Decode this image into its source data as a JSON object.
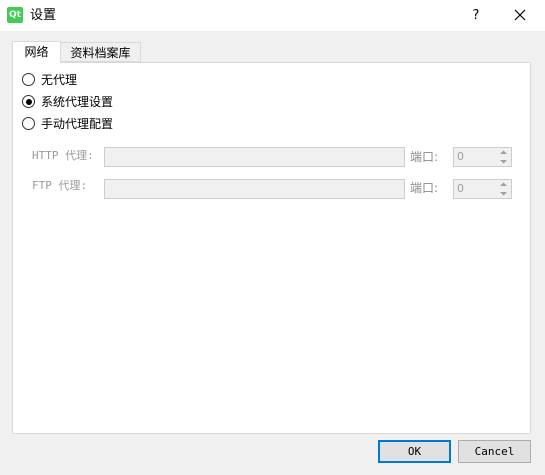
{
  "window": {
    "app_icon_text": "Qt",
    "title": "设置",
    "help_label": "?"
  },
  "tabs": [
    {
      "label": "网络",
      "active": true
    },
    {
      "label": "资料档案库",
      "active": false
    }
  ],
  "proxy_options": [
    {
      "label": "无代理",
      "checked": false
    },
    {
      "label": "系统代理设置",
      "checked": true
    },
    {
      "label": "手动代理配置",
      "checked": false
    }
  ],
  "manual": {
    "http": {
      "label": "HTTP 代理:",
      "value": "",
      "port_label": "端口:",
      "port_value": "0"
    },
    "ftp": {
      "label": "FTP 代理:",
      "value": "",
      "port_label": "端口:",
      "port_value": "0"
    }
  },
  "buttons": {
    "ok": "OK",
    "cancel": "Cancel"
  },
  "colors": {
    "accent": "#0078d7",
    "qt_green": "#41cd52"
  }
}
